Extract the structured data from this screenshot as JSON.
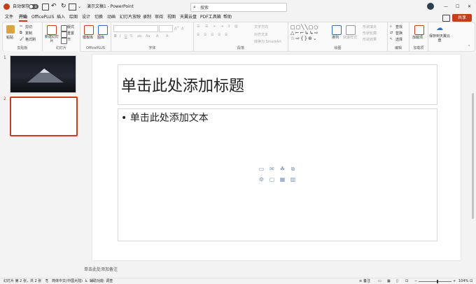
{
  "titlebar": {
    "autosave": "自动保存",
    "toggle": "关",
    "doc_title": "演示文稿1 - PowerPoint",
    "search_placeholder": "搜索"
  },
  "tabs": [
    "文件",
    "开始",
    "OfficePLUS",
    "插入",
    "绘图",
    "设计",
    "切换",
    "动画",
    "幻灯片放映",
    "录制",
    "审阅",
    "视图",
    "天翼云盘",
    "PDF工具箱",
    "帮助"
  ],
  "active_tab": "开始",
  "share_label": "共享",
  "ribbon": {
    "clipboard": {
      "label": "剪贴板",
      "paste": "粘贴",
      "cut": "剪切",
      "copy": "复制",
      "format_painter": "格式刷"
    },
    "slides": {
      "label": "幻灯片",
      "new_slide": "新建幻灯片",
      "layout": "版式",
      "reset": "重置",
      "section": "节"
    },
    "officeplus": {
      "label": "OfficePLUS",
      "template": "模板库",
      "icon_lib": "图库"
    },
    "font": {
      "label": "字体"
    },
    "paragraph": {
      "label": "段落",
      "text_direction": "文字方向",
      "align_text": "对齐文本",
      "smartart": "转换为 SmartArt"
    },
    "drawing": {
      "label": "绘图",
      "arrange": "排列",
      "quick_styles": "快速样式",
      "shape_fill": "形状填充",
      "shape_outline": "形状轮廓",
      "shape_effects": "形状效果"
    },
    "editing": {
      "label": "编辑",
      "find": "查找",
      "replace": "替换",
      "select": "选择"
    },
    "addins": {
      "label": "加载项",
      "addin": "加载项"
    },
    "cloud": {
      "save": "保存到天翼云盘"
    }
  },
  "slides_pane": {
    "numbers": [
      "1",
      "2"
    ]
  },
  "slide": {
    "title_placeholder": "单击此处添加标题",
    "body_placeholder": "单击此处添加文本"
  },
  "notes_placeholder": "单击此处添加备注",
  "status": {
    "slide_count": "幻灯片 第 2 张，共 2 张",
    "language": "简体中文(中国大陆)",
    "accessibility": "辅助功能: 调查",
    "notes": "备注",
    "zoom": "104%"
  },
  "colors": {
    "accent": "#c43e1c",
    "icon_blue": "#7a95b8"
  }
}
